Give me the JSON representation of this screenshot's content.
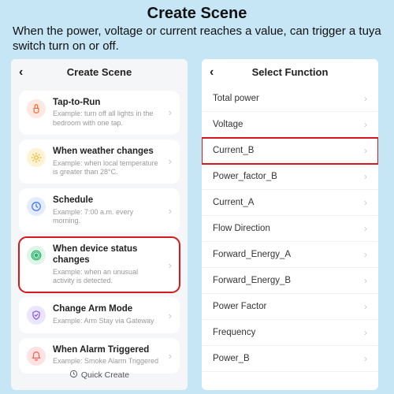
{
  "page": {
    "title": "Create Scene",
    "subtitle": "When the power, voltage or current reaches a value, can trigger a tuya switch turn on or off."
  },
  "left": {
    "header": "Create Scene",
    "quick_create": "Quick Create",
    "cards": [
      {
        "title": "Tap-to-Run",
        "sub": "Example: turn off all lights in the bedroom with one tap.",
        "icon": "tap",
        "iconBg": "#fde8e2",
        "iconColor": "#f06a3a",
        "highlight": false
      },
      {
        "title": "When weather changes",
        "sub": "Example: when local temperature is greater than 28°C.",
        "icon": "sun",
        "iconBg": "#fff3d6",
        "iconColor": "#f2b21b",
        "highlight": false
      },
      {
        "title": "Schedule",
        "sub": "Example: 7:00 a.m. every morning.",
        "icon": "clock",
        "iconBg": "#e3edff",
        "iconColor": "#3a6df0",
        "highlight": false
      },
      {
        "title": "When device status changes",
        "sub": "Example: when an unusual activity is detected.",
        "icon": "device",
        "iconBg": "#dff5e8",
        "iconColor": "#27b36a",
        "highlight": true
      },
      {
        "title": "Change Arm Mode",
        "sub": "Example: Arm Stay via Gateway",
        "icon": "shield",
        "iconBg": "#ece5ff",
        "iconColor": "#7a52e6",
        "highlight": false
      },
      {
        "title": "When Alarm Triggered",
        "sub": "Example: Smoke Alarm Triggered",
        "icon": "alarm",
        "iconBg": "#ffe3e3",
        "iconColor": "#ff5a4d",
        "highlight": false
      }
    ]
  },
  "right": {
    "header": "Select Function",
    "items": [
      {
        "label": "Total power",
        "highlight": false
      },
      {
        "label": "Voltage",
        "highlight": false
      },
      {
        "label": "Current_B",
        "highlight": true
      },
      {
        "label": "Power_factor_B",
        "highlight": false
      },
      {
        "label": "Current_A",
        "highlight": false
      },
      {
        "label": "Flow Direction",
        "highlight": false
      },
      {
        "label": "Forward_Energy_A",
        "highlight": false
      },
      {
        "label": "Forward_Energy_B",
        "highlight": false
      },
      {
        "label": "Power Factor",
        "highlight": false
      },
      {
        "label": "Frequency",
        "highlight": false
      },
      {
        "label": "Power_B",
        "highlight": false
      }
    ]
  }
}
